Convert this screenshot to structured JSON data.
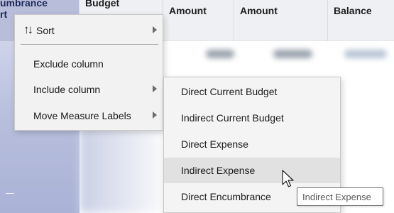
{
  "table": {
    "headers": [
      {
        "line1": "umbrance",
        "line2": "rt"
      },
      {
        "line1": "Budget"
      },
      {
        "line1": "Amount"
      },
      {
        "line1": "Amount"
      },
      {
        "line1": "Balance"
      }
    ]
  },
  "context_menu": {
    "items": [
      {
        "label": "Sort",
        "icon": "sort-icon",
        "has_submenu": true
      },
      {
        "label": "Exclude column",
        "has_submenu": false
      },
      {
        "label": "Include column",
        "has_submenu": true
      },
      {
        "label": "Move Measure Labels",
        "has_submenu": true
      }
    ],
    "sort_glyph": "↑↓"
  },
  "submenu": {
    "items": [
      {
        "label": "Direct Current Budget"
      },
      {
        "label": "Indirect Current Budget"
      },
      {
        "label": "Direct Expense"
      },
      {
        "label": "Indirect Expense",
        "hovered": true
      },
      {
        "label": "Direct Encumbrance"
      }
    ]
  },
  "tooltip": {
    "text": "Indirect Expense"
  },
  "colors": {
    "menu_bg": "#f2f2f2",
    "hover_bg": "#e1e1e1",
    "header_bg": "#eef0f3",
    "selected_column": "#b8bed9"
  }
}
